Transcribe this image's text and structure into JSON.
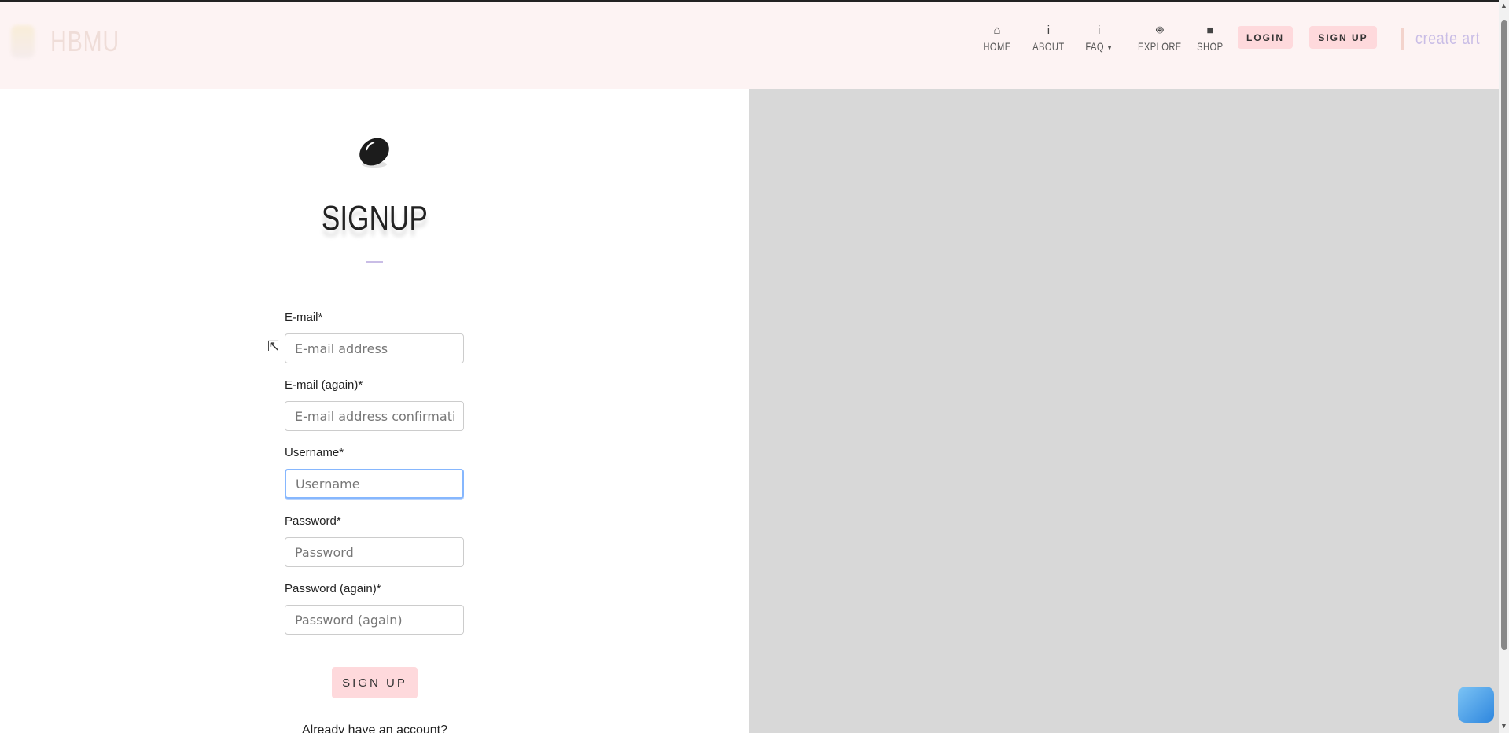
{
  "header": {
    "logo_text": "HBMU",
    "nav": [
      {
        "label": "HOME",
        "icon": "home-icon"
      },
      {
        "label": "ABOUT",
        "icon": "info-icon"
      },
      {
        "label": "FAQ",
        "icon": "info-icon"
      },
      {
        "label": "EXPLORE",
        "icon": "robot-icon"
      },
      {
        "label": "SHOP",
        "icon": "shopping-bag-icon"
      }
    ],
    "login_label": "LOGIN",
    "signup_label": "SIGN UP",
    "create_art": "create art"
  },
  "form": {
    "title": "SIGNUP",
    "fields": [
      {
        "label": "E-mail*",
        "placeholder": "E-mail address"
      },
      {
        "label": "E-mail (again)*",
        "placeholder": "E-mail address confirmation"
      },
      {
        "label": "Username*",
        "placeholder": "Username"
      },
      {
        "label": "Password*",
        "placeholder": "Password"
      },
      {
        "label": "Password (again)*",
        "placeholder": "Password (again)"
      }
    ],
    "submit_label": "SIGN UP",
    "already": "Already have an account?"
  },
  "colors": {
    "accent": "#fed9dc",
    "header_bg": "#fdf3f3",
    "lavender": "#c9bde6"
  }
}
